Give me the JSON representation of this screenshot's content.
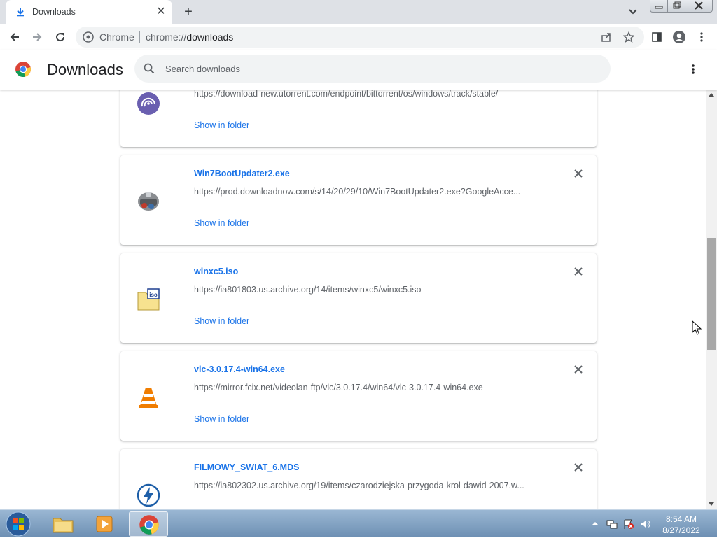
{
  "tab": {
    "title": "Downloads",
    "close_symbol": "✕",
    "new_tab_symbol": "+"
  },
  "omnibox": {
    "site": "Chrome",
    "url_scheme": "chrome://",
    "url_path": "downloads"
  },
  "page": {
    "title": "Downloads",
    "search_placeholder": "Search downloads"
  },
  "downloads": [
    {
      "name": "",
      "url": "https://download-new.utorrent.com/endpoint/bittorrent/os/windows/track/stable/",
      "action": "Show in folder",
      "icon": "bittorrent-icon"
    },
    {
      "name": "Win7BootUpdater2.exe",
      "url": "https://prod.downloadnow.com/s/14/20/29/10/Win7BootUpdater2.exe?GoogleAcce...",
      "action": "Show in folder",
      "icon": "win7bootupdater-icon"
    },
    {
      "name": "winxc5.iso",
      "url": "https://ia801803.us.archive.org/14/items/winxc5/winxc5.iso",
      "action": "Show in folder",
      "icon": "iso-file-icon"
    },
    {
      "name": "vlc-3.0.17.4-win64.exe",
      "url": "https://mirror.fcix.net/videolan-ftp/vlc/3.0.17.4/win64/vlc-3.0.17.4-win64.exe",
      "action": "Show in folder",
      "icon": "vlc-icon"
    },
    {
      "name": "FILMOWY_SWIAT_6.MDS",
      "url": "https://ia802302.us.archive.org/19/items/czarodziejska-przygoda-krol-dawid-2007.w...",
      "action": "",
      "icon": "daemon-tools-icon"
    }
  ],
  "tray": {
    "time": "8:54 AM",
    "date": "8/27/2022"
  },
  "colors": {
    "link": "#1a73e8",
    "tab_strip": "#dee1e6",
    "taskbar": "#7b9cbf"
  }
}
